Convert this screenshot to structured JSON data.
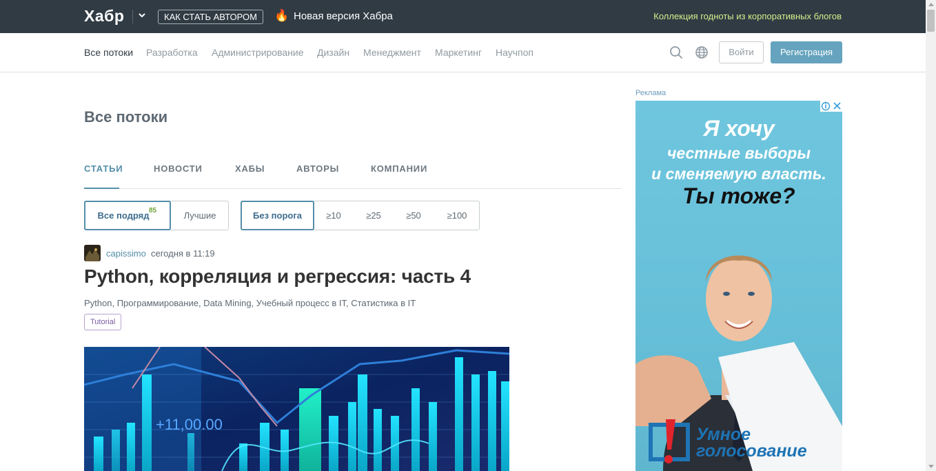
{
  "topbar": {
    "logo": "Хабр",
    "author_button": "Как стать автором",
    "new_version": "Новая версия Хабра",
    "collection": "Коллекция годноты из корпоративных блогов"
  },
  "nav": {
    "items": [
      "Все потоки",
      "Разработка",
      "Администрирование",
      "Дизайн",
      "Менеджмент",
      "Маркетинг",
      "Научпоп"
    ],
    "login": "Войти",
    "register": "Регистрация"
  },
  "page": {
    "title": "Все потоки",
    "tabs": [
      "Статьи",
      "Новости",
      "Хабы",
      "Авторы",
      "Компании"
    ]
  },
  "filters": {
    "sort": [
      "Все подряд",
      "Лучшие"
    ],
    "sort_count": "85",
    "threshold": [
      "Без порога",
      "≥10",
      "≥25",
      "≥50",
      "≥100"
    ]
  },
  "post": {
    "author": "capissimo",
    "time": "сегодня в 11:19",
    "title": "Python, корреляция и регрессия: часть 4",
    "hubs": "Python,  Программирование,  Data Mining,  Учебный процесс в IT,  Статистика в IT",
    "badge": "Tutorial",
    "image_text": "+11,00.00"
  },
  "ad": {
    "label": "Реклама",
    "line1": "Я хочу",
    "line2": "честные выборы",
    "line3": "и сменяемую власть.",
    "line4": "Ты тоже?",
    "brand1": "Умное",
    "brand2": "голосование"
  },
  "colors": {
    "topbar": "#303b44",
    "accent": "#548eaa",
    "register": "#65a3be",
    "ad_bg": "#6fc6de"
  }
}
